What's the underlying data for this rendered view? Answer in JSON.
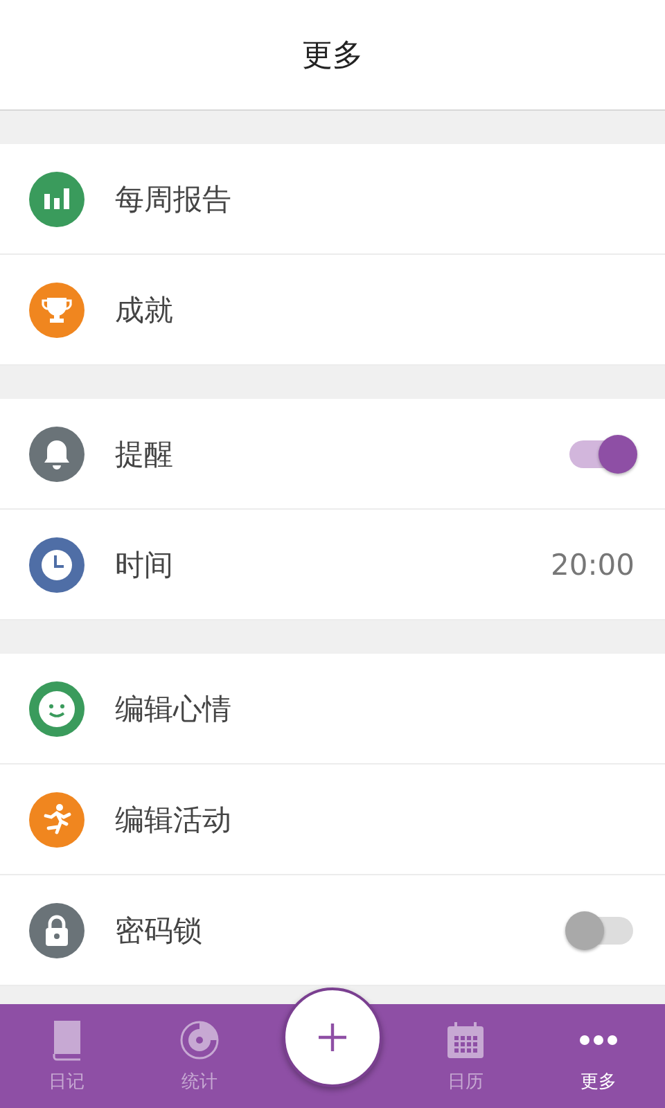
{
  "header": {
    "title": "更多"
  },
  "sections": [
    {
      "items": [
        {
          "kind": "link",
          "label": "每周报告",
          "color": "#3a9b5c"
        },
        {
          "kind": "link",
          "label": "成就",
          "color": "#f0861f"
        }
      ]
    },
    {
      "items": [
        {
          "kind": "toggle",
          "label": "提醒",
          "color": "#6a7378",
          "on": true
        },
        {
          "kind": "value",
          "label": "时间",
          "color": "#4f6ea6",
          "value": "20:00"
        }
      ]
    },
    {
      "items": [
        {
          "kind": "link",
          "label": "编辑心情",
          "color": "#3a9b5c"
        },
        {
          "kind": "link",
          "label": "编辑活动",
          "color": "#f0861f"
        },
        {
          "kind": "toggle",
          "label": "密码锁",
          "color": "#6a7378",
          "on": false
        }
      ]
    }
  ],
  "nav": [
    {
      "label": "日记",
      "selected": false
    },
    {
      "label": "统计",
      "selected": false
    },
    {
      "label": "日历",
      "selected": false
    },
    {
      "label": "更多",
      "selected": true
    }
  ]
}
